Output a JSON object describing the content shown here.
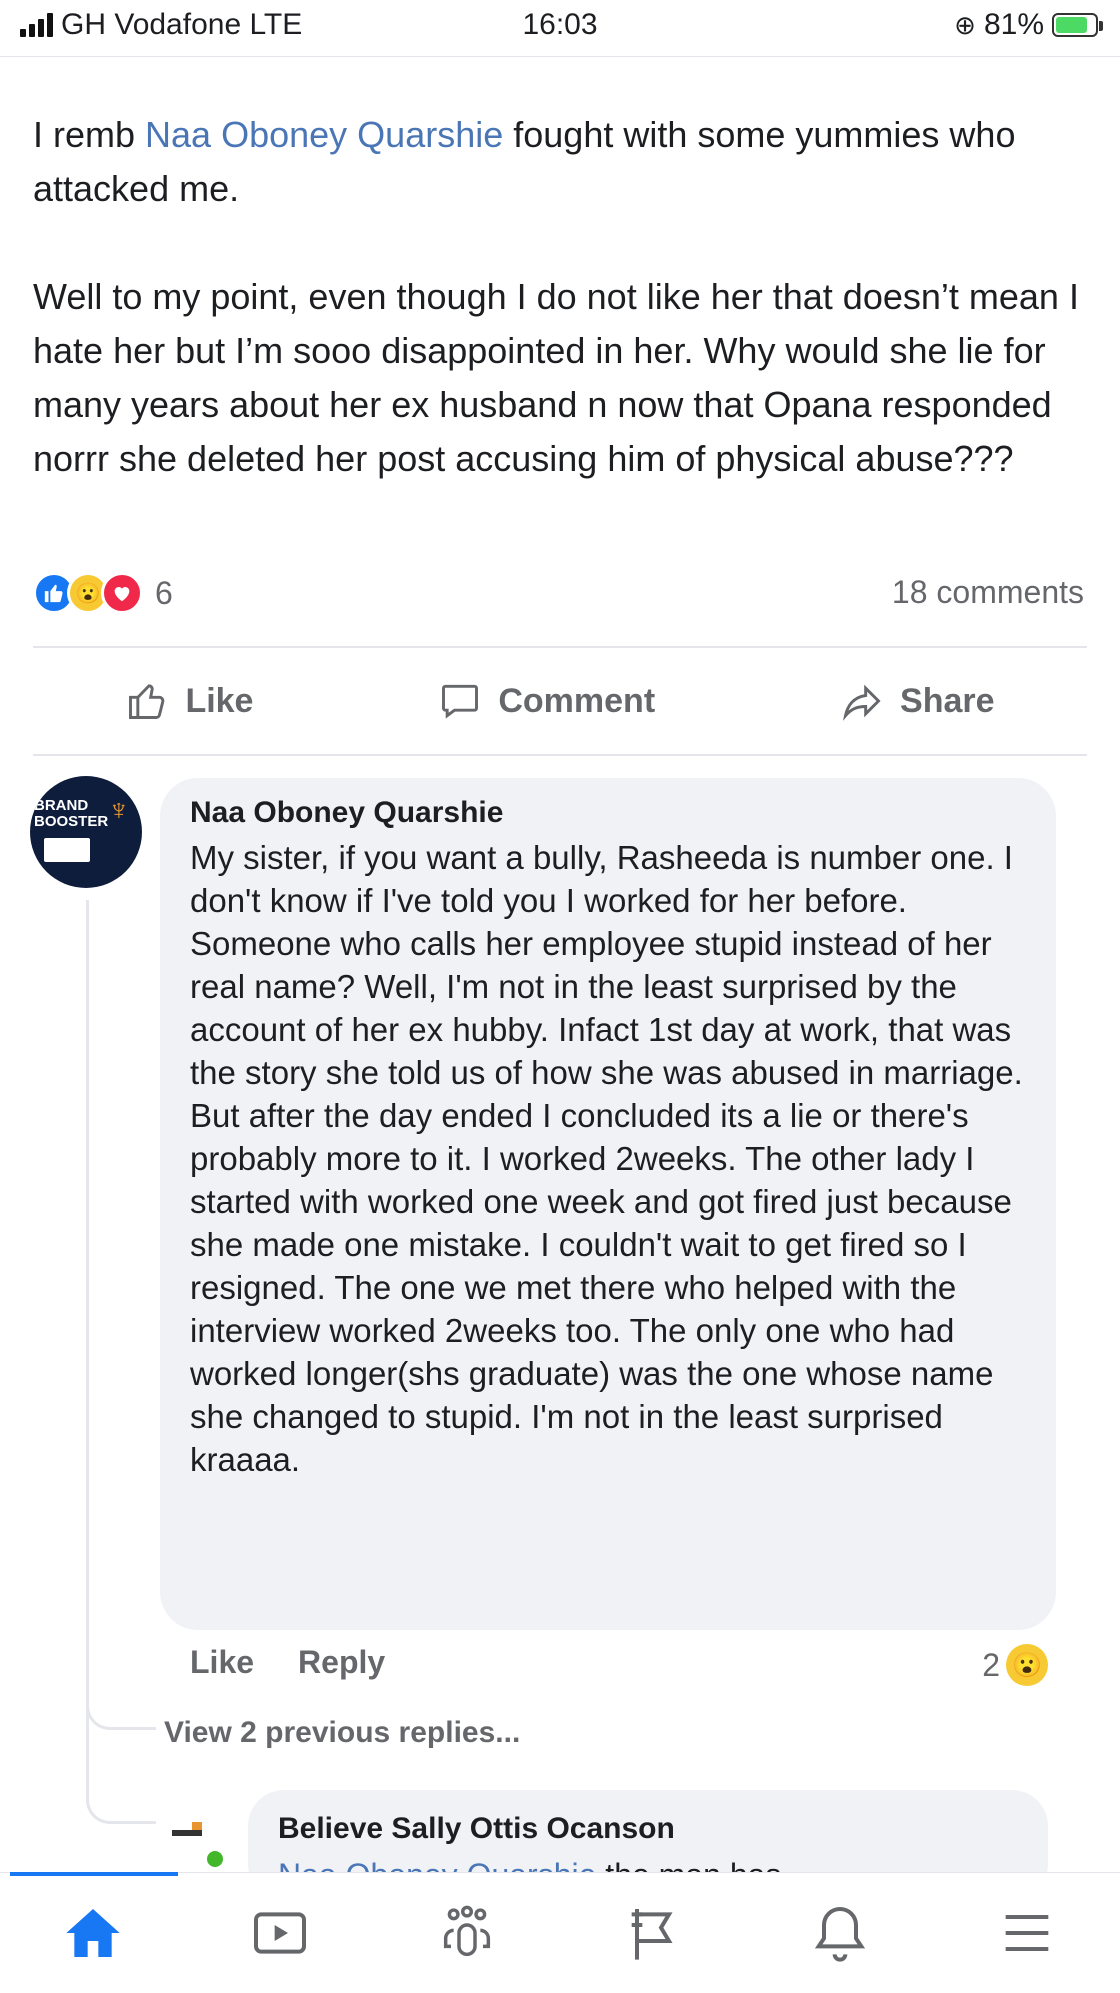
{
  "status_bar": {
    "carrier": "GH Vodafone LTE",
    "time": "16:03",
    "battery_percent": "81%",
    "battery_level": 0.81
  },
  "post": {
    "line1_pre": "I remb ",
    "line1_mention": "Naa Oboney Quarshie",
    "line1_post": " fought with some yummies who attacked me.",
    "paragraph2": "Well to my point, even though I  do not like her that doesn’t mean I hate her but I’m sooo disappointed in her. Why would she lie for many years about her ex husband n now that Opana responded norrr she deleted her post accusing him of physical abuse???",
    "reaction_count": "6",
    "comments_count": "18 comments",
    "reactions": [
      "like-icon",
      "wow-icon",
      "love-icon"
    ]
  },
  "actions": {
    "like": "Like",
    "comment": "Comment",
    "share": "Share"
  },
  "comment": {
    "avatar_text": "BRAND BOOSTER",
    "author": "Naa Oboney Quarshie",
    "text": "My sister, if you want a bully, Rasheeda is number one. I don't know if I've told you I worked for her before. Someone who calls her employee stupid instead of her real name? Well, I'm not in the least surprised by the account of her ex hubby. Infact 1st day at work, that was the story she told us of how she was abused in marriage. But after the day ended I concluded its a lie  or there's probably more to it.  I worked 2weeks. The other lady I started with worked one week and got fired just because she made one mistake. I couldn't wait to get fired so I resigned. The one we met there who helped with the interview worked 2weeks too. The only one who had worked longer(shs graduate) was the one whose name she changed to stupid.  I'm not in the least surprised kraaaa.",
    "like": "Like",
    "reply": "Reply",
    "reaction_count": "2"
  },
  "view_replies": "View 2 previous replies...",
  "reply": {
    "author": "Believe Sally Ottis Ocanson",
    "mention": "Naa Oboney Quarshie",
    "text_after": " the man has"
  },
  "nav": [
    "home-icon",
    "watch-icon",
    "groups-icon",
    "pages-icon",
    "notifications-icon",
    "menu-icon"
  ],
  "colors": {
    "accent": "#1877f2",
    "mention": "#4a76b6",
    "secondary_text": "#65676b",
    "bubble": "#f0f2f5"
  }
}
